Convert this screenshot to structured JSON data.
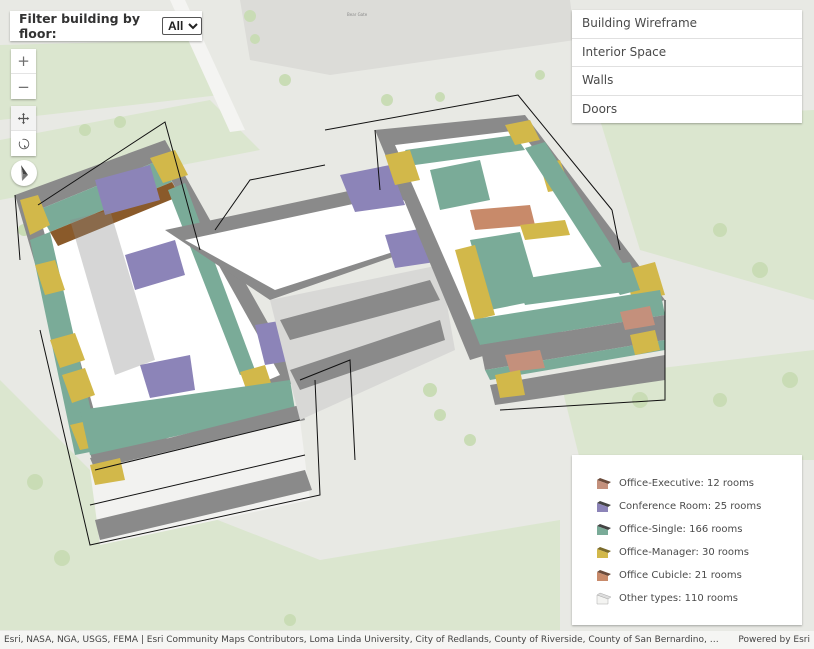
{
  "filter": {
    "label": "Filter building by floor:",
    "selected": "All",
    "options": [
      "All"
    ]
  },
  "navigation": {
    "zoom_in_label": "+",
    "zoom_out_label": "−",
    "pan_icon": "pan-icon",
    "rotate_icon": "rotate-icon",
    "compass_icon": "compass-icon"
  },
  "layer_list": {
    "items": [
      {
        "label": "Building Wireframe"
      },
      {
        "label": "Interior Space"
      },
      {
        "label": "Walls"
      },
      {
        "label": "Doors"
      }
    ]
  },
  "legend": {
    "items": [
      {
        "label": "Office-Executive: 12 rooms",
        "color": "#c4907c"
      },
      {
        "label": "Conference Room: 25 rooms",
        "color": "#8c84b8"
      },
      {
        "label": "Office-Single: 166 rooms",
        "color": "#7aab98"
      },
      {
        "label": "Office-Manager: 30 rooms",
        "color": "#d2b84a"
      },
      {
        "label": "Office Cubicle: 21 rooms",
        "color": "#c88a6a"
      },
      {
        "label": "Other types: 110 rooms",
        "color": "#f4f4f2"
      }
    ]
  },
  "map": {
    "street_label": "Bear Gate",
    "colors": {
      "basemap": "#e8e9e4",
      "park": "#dbe6cf",
      "wall": "#7a7a7a",
      "door": "#8a5a2a",
      "floor": "#ffffff"
    }
  },
  "attribution": {
    "sources": "Esri, NASA, NGA, USGS, FEMA | Esri Community Maps Contributors, Loma Linda University, City of Redlands, County of Riverside, County of San Bernardino, California State Pa…",
    "powered_by": "Powered by Esri"
  }
}
